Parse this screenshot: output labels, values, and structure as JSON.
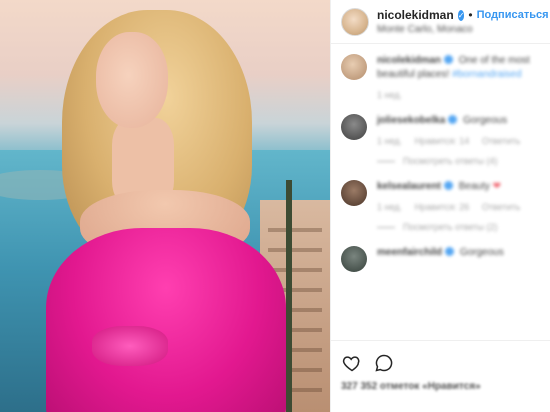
{
  "header": {
    "username": "nicolekidman",
    "separator": "•",
    "follow_label": "Подписаться",
    "location": "Monte Carlo, Monaco"
  },
  "comments": [
    {
      "user": "nicolekidman",
      "text": "One of the most beautiful places!",
      "tag": "#bornandraised",
      "time": "1 нед."
    },
    {
      "user": "joliesekobelka",
      "text": "Gorgeous",
      "time": "1 нед.",
      "likes": "Нравится: 14",
      "reply": "Ответить",
      "view_replies": "Посмотреть ответы (4)"
    },
    {
      "user": "kelsealaurent",
      "text": "Beauty",
      "time": "1 нед.",
      "likes": "Нравится: 26",
      "reply": "Ответить",
      "view_replies": "Посмотреть ответы (2)"
    },
    {
      "user": "meenfairchild",
      "text": "Gorgeous",
      "time": "",
      "likes": "",
      "reply": ""
    }
  ],
  "footer": {
    "likes_text": "327 352 отметок «Нравится»"
  },
  "colors": {
    "accent": "#3897f0",
    "dress": "#e2188f",
    "heart_red": "#ed4956"
  },
  "icons": {
    "verified": "verified-badge-icon",
    "like": "heart-icon",
    "comment": "comment-bubble-icon",
    "share": "share-icon",
    "save": "bookmark-icon"
  }
}
